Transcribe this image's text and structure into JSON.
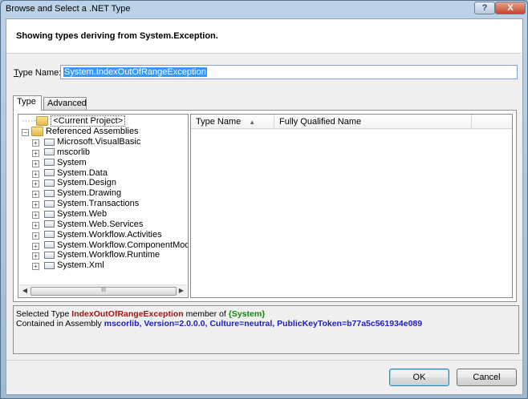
{
  "window": {
    "title": "Browse and Select a .NET Type",
    "help_glyph": "?",
    "close_glyph": "X"
  },
  "header": {
    "text": "Showing types deriving from System.Exception."
  },
  "type_name": {
    "label_accel": "T",
    "label_rest": "ype Name:",
    "value": "System.IndexOutOfRangeException"
  },
  "tabs": [
    {
      "label": "Type",
      "selected": true
    },
    {
      "label": "Advanced",
      "selected": false
    }
  ],
  "tree": {
    "current_project": "<Current Project>",
    "referenced_assemblies": "Referenced Assemblies",
    "assemblies": [
      "Microsoft.VisualBasic",
      "mscorlib",
      "System",
      "System.Data",
      "System.Design",
      "System.Drawing",
      "System.Transactions",
      "System.Web",
      "System.Web.Services",
      "System.Workflow.Activities",
      "System.Workflow.ComponentModel",
      "System.Workflow.Runtime",
      "System.Xml"
    ],
    "expander_plus": "+",
    "expander_minus": "−",
    "scroll_left": "◀",
    "scroll_right": "▶",
    "scroll_thumb": "III"
  },
  "list": {
    "columns": [
      "Type Name",
      "Fully Qualified Name"
    ],
    "sort_glyph": "▲"
  },
  "info": {
    "line1_prefix": "Selected Type ",
    "type_name": "IndexOutOfRangeException",
    "line1_mid": " member of ",
    "namespace": "{System}",
    "line2_prefix": "Contained in Assembly ",
    "assembly": "mscorlib, Version=2.0.0.0, Culture=neutral, PublicKeyToken=b77a5c561934e089"
  },
  "buttons": {
    "ok": "OK",
    "cancel": "Cancel"
  }
}
